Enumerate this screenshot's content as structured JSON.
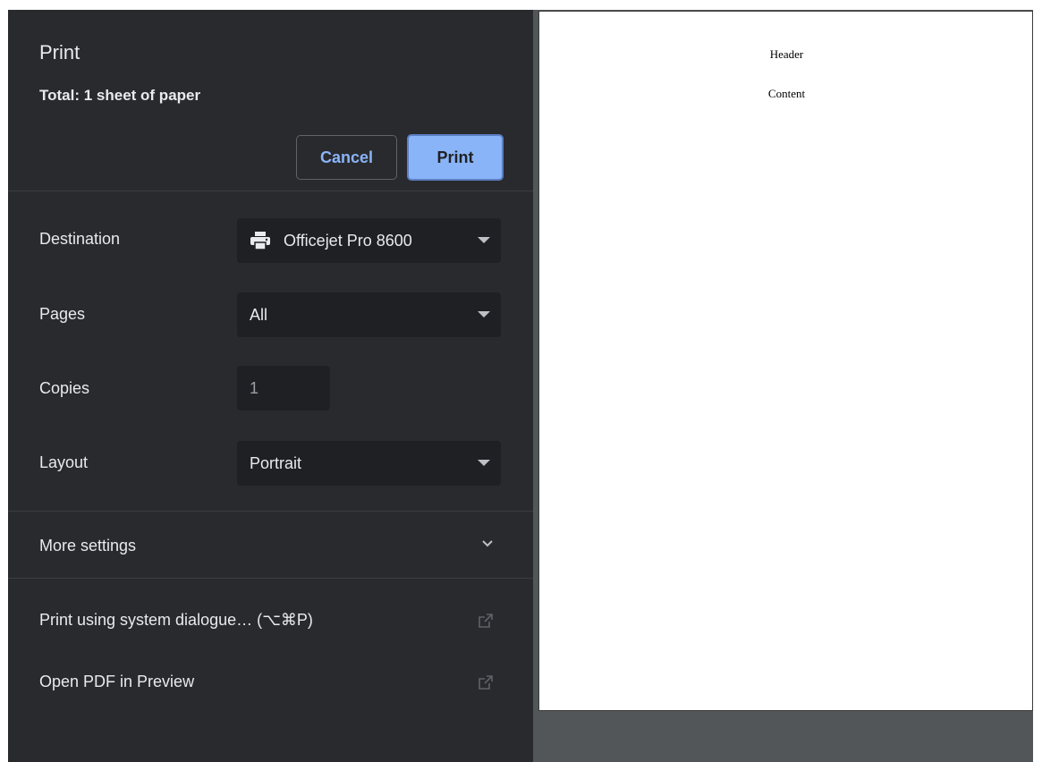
{
  "dialog": {
    "title": "Print",
    "summary": "Total: 1 sheet of paper",
    "cancel_label": "Cancel",
    "print_label": "Print"
  },
  "settings": {
    "destination": {
      "label": "Destination",
      "value": "Officejet Pro 8600",
      "icon": "printer-icon"
    },
    "pages": {
      "label": "Pages",
      "value": "All"
    },
    "copies": {
      "label": "Copies",
      "value": "1"
    },
    "layout": {
      "label": "Layout",
      "value": "Portrait"
    },
    "more_settings": "More settings"
  },
  "links": {
    "system_dialog": "Print using system dialogue… (⌥⌘P)",
    "open_pdf": "Open PDF in Preview"
  },
  "preview": {
    "header": "Header",
    "content": "Content"
  },
  "colors": {
    "panel_bg": "#292a2d",
    "accent": "#8ab4f8",
    "preview_bg": "#525659"
  }
}
